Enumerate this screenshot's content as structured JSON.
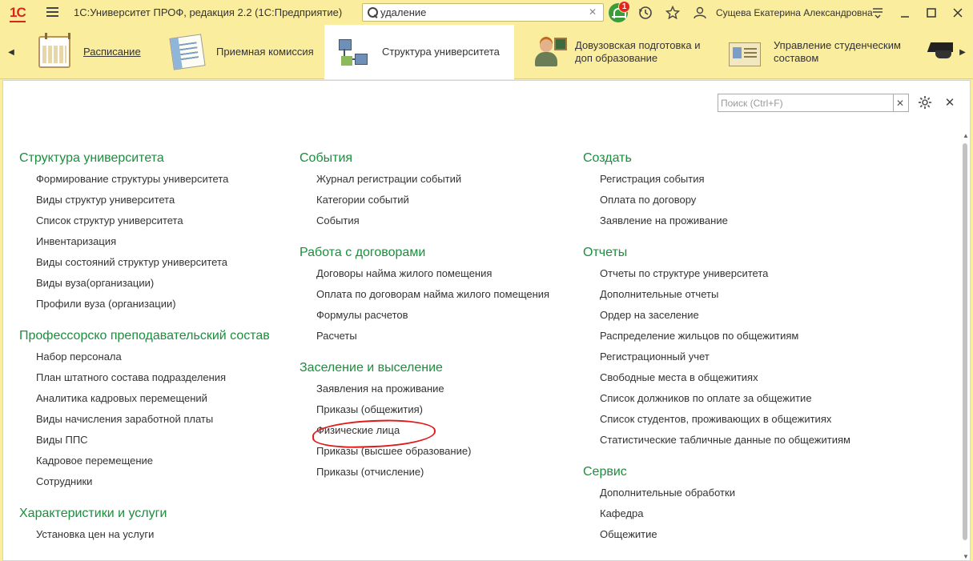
{
  "app": {
    "logo_text": "1С",
    "title": "1С:Университет ПРОФ, редакция 2.2  (1С:Предприятие)",
    "search_value": "удаление",
    "notification_count": "1",
    "user_name": "Сущева Екатерина Александровна"
  },
  "sections": [
    {
      "label": "Расписание"
    },
    {
      "label": "Приемная комиссия"
    },
    {
      "label": "Структура университета"
    },
    {
      "label": "Довузовская подготовка и доп образование"
    },
    {
      "label": "Управление студенческим составом"
    }
  ],
  "panel": {
    "filter_placeholder": "Поиск (Ctrl+F)"
  },
  "columns": [
    {
      "groups": [
        {
          "title": "Структура университета",
          "items": [
            "Формирование структуры университета",
            "Виды структур университета",
            "Список структур университета",
            "Инвентаризация",
            "Виды состояний структур университета",
            "Виды вуза(организации)",
            "Профили вуза (организации)"
          ]
        },
        {
          "title": "Профессорско преподавательский состав",
          "items": [
            "Набор персонала",
            "План штатного состава подразделения",
            "Аналитика кадровых перемещений",
            "Виды начисления заработной платы",
            "Виды ППС",
            "Кадровое перемещение",
            "Сотрудники"
          ]
        },
        {
          "title": "Характеристики и услуги",
          "items": [
            "Установка цен на услуги"
          ]
        }
      ]
    },
    {
      "groups": [
        {
          "title": "События",
          "items": [
            "Журнал регистрации событий",
            "Категории событий",
            "События"
          ]
        },
        {
          "title": "Работа с договорами",
          "items": [
            "Договоры найма жилого помещения",
            "Оплата по договорам найма жилого помещения",
            "Формулы расчетов",
            "Расчеты"
          ]
        },
        {
          "title": "Заселение и выселение",
          "items": [
            "Заявления на проживание",
            "Приказы (общежития)",
            "Физические лица",
            "Приказы (высшее образование)",
            "Приказы (отчисление)"
          ]
        }
      ]
    },
    {
      "groups": [
        {
          "title": "Создать",
          "items": [
            "Регистрация события",
            "Оплата по договору",
            "Заявление на проживание"
          ]
        },
        {
          "title": "Отчеты",
          "items": [
            "Отчеты по структуре университета",
            "Дополнительные отчеты",
            "Ордер на заселение",
            "Распределение жильцов по общежитиям",
            "Регистрационный учет",
            "Свободные места в общежитиях",
            "Список должников по оплате за общежитие",
            "Список студентов, проживающих в общежитиях",
            "Статистические табличные данные по общежитиям"
          ]
        },
        {
          "title": "Сервис",
          "items": [
            "Дополнительные обработки",
            "Кафедра",
            "Общежитие"
          ]
        }
      ]
    }
  ]
}
